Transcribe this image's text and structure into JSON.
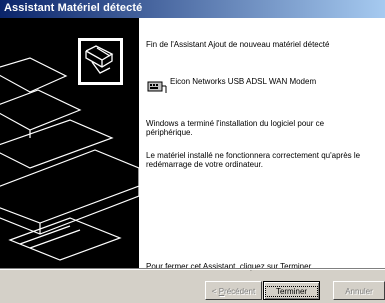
{
  "window": {
    "title": "Assistant Matériel détecté"
  },
  "content": {
    "heading": "Fin de l'Assistant Ajout de nouveau matériel détecté",
    "device_name": "Eicon Networks USB ADSL WAN Modem",
    "finished_line1": "Windows a terminé l'installation du logiciel pour ce",
    "finished_line2": "périphérique.",
    "restart_line1": "Le matériel installé ne fonctionnera correctement qu'après le",
    "restart_line2": "redémarrage de votre ordinateur.",
    "close_hint": "Pour fermer cet Assistant, cliquez sur Terminer."
  },
  "buttons": {
    "back": {
      "prefix": "< ",
      "accel": "P",
      "rest": "récédent"
    },
    "finish": "Terminer",
    "cancel": "Annuler"
  }
}
